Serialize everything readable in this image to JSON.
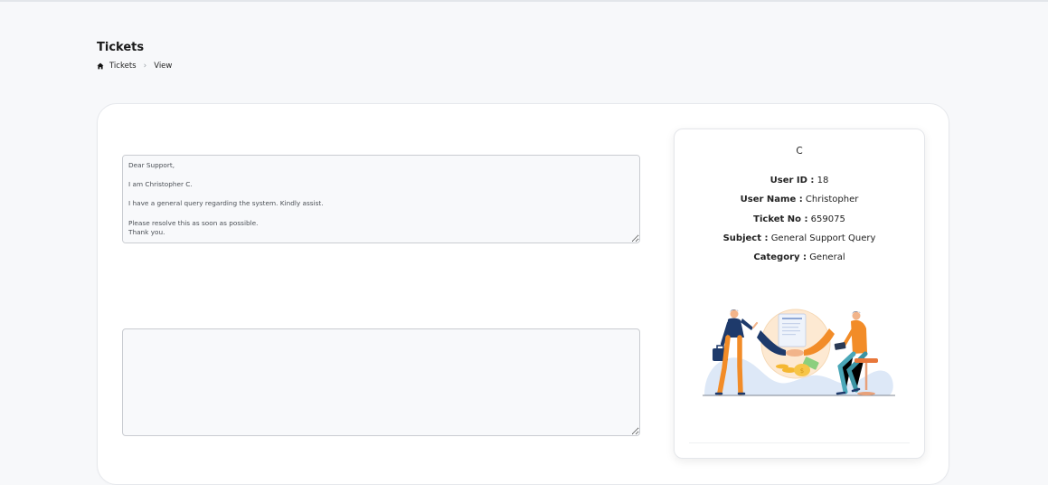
{
  "page": {
    "title": "Tickets"
  },
  "breadcrumb": {
    "items": [
      "Tickets",
      "View"
    ]
  },
  "ticket": {
    "message": "Dear Support,\n\nI am Christopher C.\n\nI have a general query regarding the system. Kindly assist.\n\nPlease resolve this as soon as possible.\nThank you.",
    "reply_value": ""
  },
  "user_card": {
    "avatar_letter": "C",
    "fields": [
      {
        "label": "User ID :",
        "value": "18"
      },
      {
        "label": "User Name :",
        "value": "Christopher"
      },
      {
        "label": "Ticket No :",
        "value": "659075"
      },
      {
        "label": "Subject :",
        "value": "General Support Query"
      },
      {
        "label": "Category :",
        "value": "General"
      }
    ]
  },
  "icons": {
    "breadcrumb_home": "home-icon",
    "breadcrumb_separator": "chevron-right-icon"
  },
  "colors": {
    "accent_orange": "#f28c28",
    "accent_navy": "#1e3a6b",
    "background": "#f7f8fa"
  }
}
